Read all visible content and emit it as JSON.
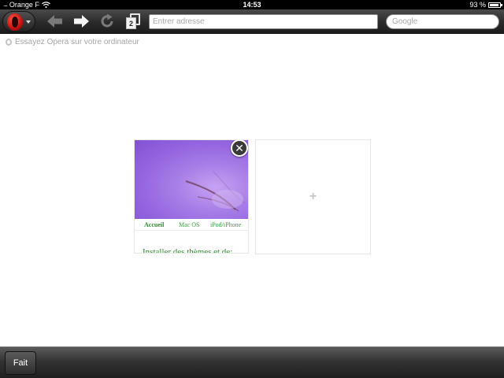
{
  "status_bar": {
    "signal": "....",
    "carrier": "Orange F",
    "time": "14:53",
    "battery": "93 %",
    "battery_level": 0.93
  },
  "toolbar": {
    "tabs_count": "2",
    "address_placeholder": "Entrer adresse",
    "search_placeholder": "Google"
  },
  "promo": {
    "text": "Essayez Opera sur votre ordinateur"
  },
  "speed_dial": {
    "tile": {
      "nav": [
        "Accueil",
        "Mac OS",
        "iPod/iPhone"
      ],
      "heading": "Installer des thèmes et de:"
    },
    "add_symbol": "+"
  },
  "bottom_bar": {
    "done_label": "Fait"
  },
  "colors": {
    "toolbar": "#2a2a2a",
    "opera_red": "#c40f0f",
    "link_green": "#3b9b3b",
    "thumb_purple": "#9466df"
  }
}
